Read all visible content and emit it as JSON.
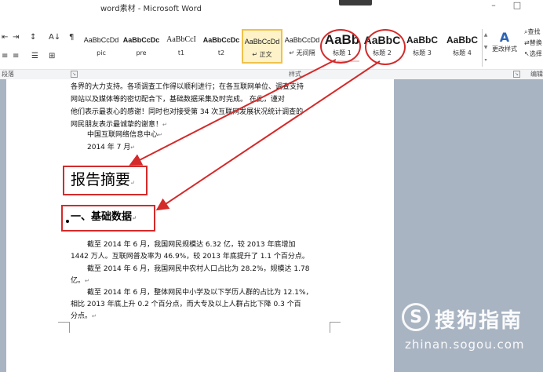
{
  "window": {
    "title": "word素材 - Microsoft Word",
    "min": "–",
    "max": "□"
  },
  "ribbon": {
    "groups": {
      "paragraph": "段落",
      "styles": "样式",
      "editing": "编辑"
    },
    "paragraph_icons": [
      "⇤",
      "⇥",
      "↕",
      "A↓",
      "¶",
      "≡",
      "≡",
      "☰",
      "⊞",
      "▣"
    ],
    "styles": [
      {
        "sample": "AaBbCcDd",
        "name": "pic",
        "selected": false
      },
      {
        "sample": "AaBbCcDc",
        "name": "pre",
        "selected": false
      },
      {
        "sample": "AaBbCcI",
        "name": "t1",
        "selected": false
      },
      {
        "sample": "AaBbCcDc",
        "name": "t2",
        "selected": false
      },
      {
        "sample": "AaBbCcDd",
        "name": "↵ 正文",
        "selected": true
      },
      {
        "sample": "AaBbCcDd",
        "name": "↵ 无间隔",
        "selected": false
      },
      {
        "sample": "AaBb",
        "name": "标题 1",
        "selected": false
      },
      {
        "sample": "AaBbC",
        "name": "标题 2",
        "selected": false
      },
      {
        "sample": "AaBbC",
        "name": "标题 3",
        "selected": false
      },
      {
        "sample": "AaBbC",
        "name": "标题 4",
        "selected": false
      }
    ],
    "change_styles": {
      "icon": "A",
      "label": "更改样式"
    },
    "editing": {
      "find": "查找",
      "replace": "替换",
      "select": "选择"
    }
  },
  "document": {
    "para1": [
      "各界的大力支持。各项调查工作得以顺利进行；在各互联网单位、调查支持",
      "网站以及媒体等的密切配合下，基础数据采集及时完成。 在此，谨对",
      "他们表示最衷心的感谢！同时也对接受第 34 次互联网发展状况统计调查的",
      "网民朋友表示最诚挚的谢意！"
    ],
    "org": "中国互联网络信息中心",
    "date": "2014 年 7 月",
    "heading1": "报告摘要",
    "heading2": "一、基础数据",
    "body": [
      "截至 2014 年 6 月，我国网民规模达 6.32 亿，较 2013 年底增加",
      "1442 万人。互联网普及率为 46.9%，较 2013 年底提升了 1.1 个百分点。",
      "截至 2014 年 6 月，我国网民中农村人口占比为 28.2%，规模达 1.78",
      "亿。",
      "截至 2014 年 6 月，整体网民中小学及以下学历人群的占比为 12.1%，",
      "相比 2013 年底上升 0.2 个百分点，而大专及以上人群占比下降 0.3 个百",
      "分点。"
    ],
    "para_mark": "↵"
  },
  "watermark": {
    "logo": "S",
    "name": "搜狗指南",
    "url": "zhinan.sogou.com"
  },
  "colors": {
    "annotation": "#d42a2a",
    "selected_style": "#f0c24b"
  }
}
